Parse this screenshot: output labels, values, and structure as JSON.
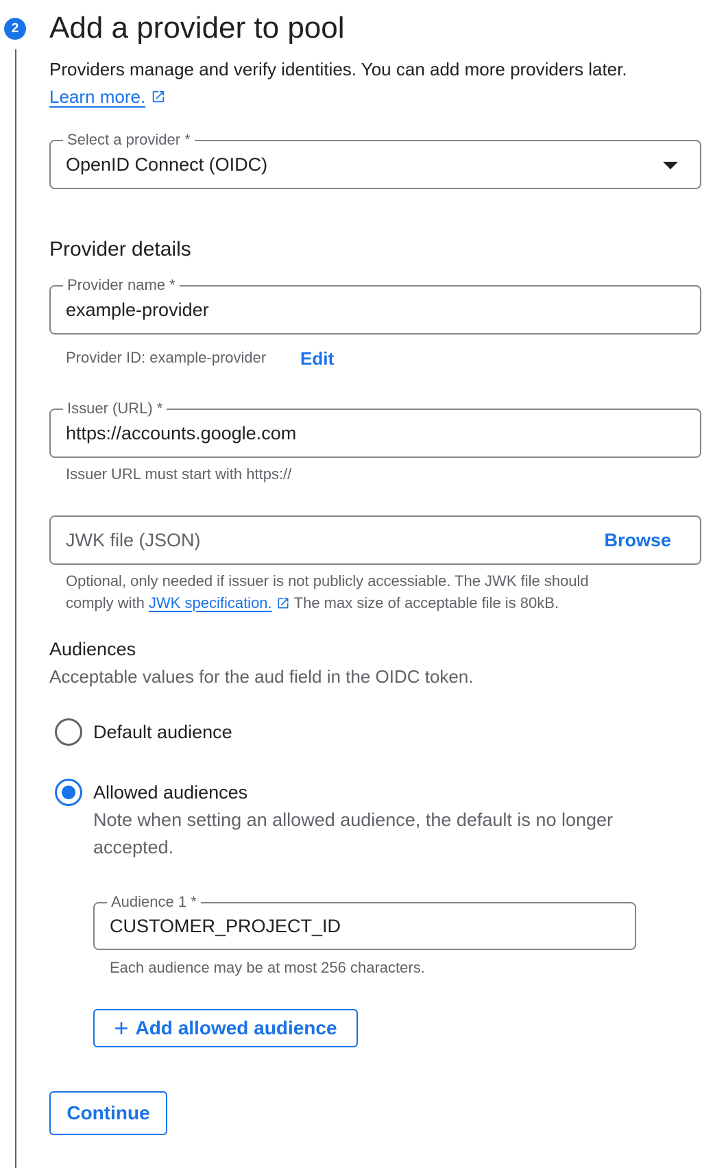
{
  "step": {
    "number": "2",
    "title": "Add a provider to pool",
    "description": "Providers manage and verify identities. You can add more providers later.",
    "learn_more": "Learn more."
  },
  "provider_select": {
    "label": "Select a provider *",
    "value": "OpenID Connect (OIDC)"
  },
  "provider_details": {
    "heading": "Provider details",
    "name_label": "Provider name *",
    "name_value": "example-provider",
    "provider_id_text": "Provider ID: example-provider",
    "edit_label": "Edit",
    "issuer_label": "Issuer (URL) *",
    "issuer_value": "https://accounts.google.com",
    "issuer_hint": "Issuer URL must start with https://",
    "jwk_placeholder": "JWK file (JSON)",
    "browse_label": "Browse",
    "jwk_hint_line1": "Optional, only needed if issuer is not publicly accessiable. The JWK file should",
    "jwk_hint_prefix": "comply with",
    "jwk_hint_link": "JWK specification.",
    "jwk_hint_suffix": "The max size of acceptable file is 80kB."
  },
  "audiences": {
    "heading": "Audiences",
    "description": "Acceptable values for the aud field in the OIDC token.",
    "default_label": "Default audience",
    "default_checked": false,
    "allowed_label": "Allowed audiences",
    "allowed_checked": true,
    "allowed_note": "Note when setting an allowed audience, the default is no longer accepted.",
    "audience1_label": "Audience 1 *",
    "audience1_value": "CUSTOMER_PROJECT_ID",
    "audience_hint": "Each audience may be at most 256 characters.",
    "add_button": "Add allowed audience"
  },
  "continue_button": "Continue",
  "colors": {
    "accent": "#1a73e8",
    "border": "#80868b",
    "text": "#202124",
    "muted": "#5f6368"
  }
}
